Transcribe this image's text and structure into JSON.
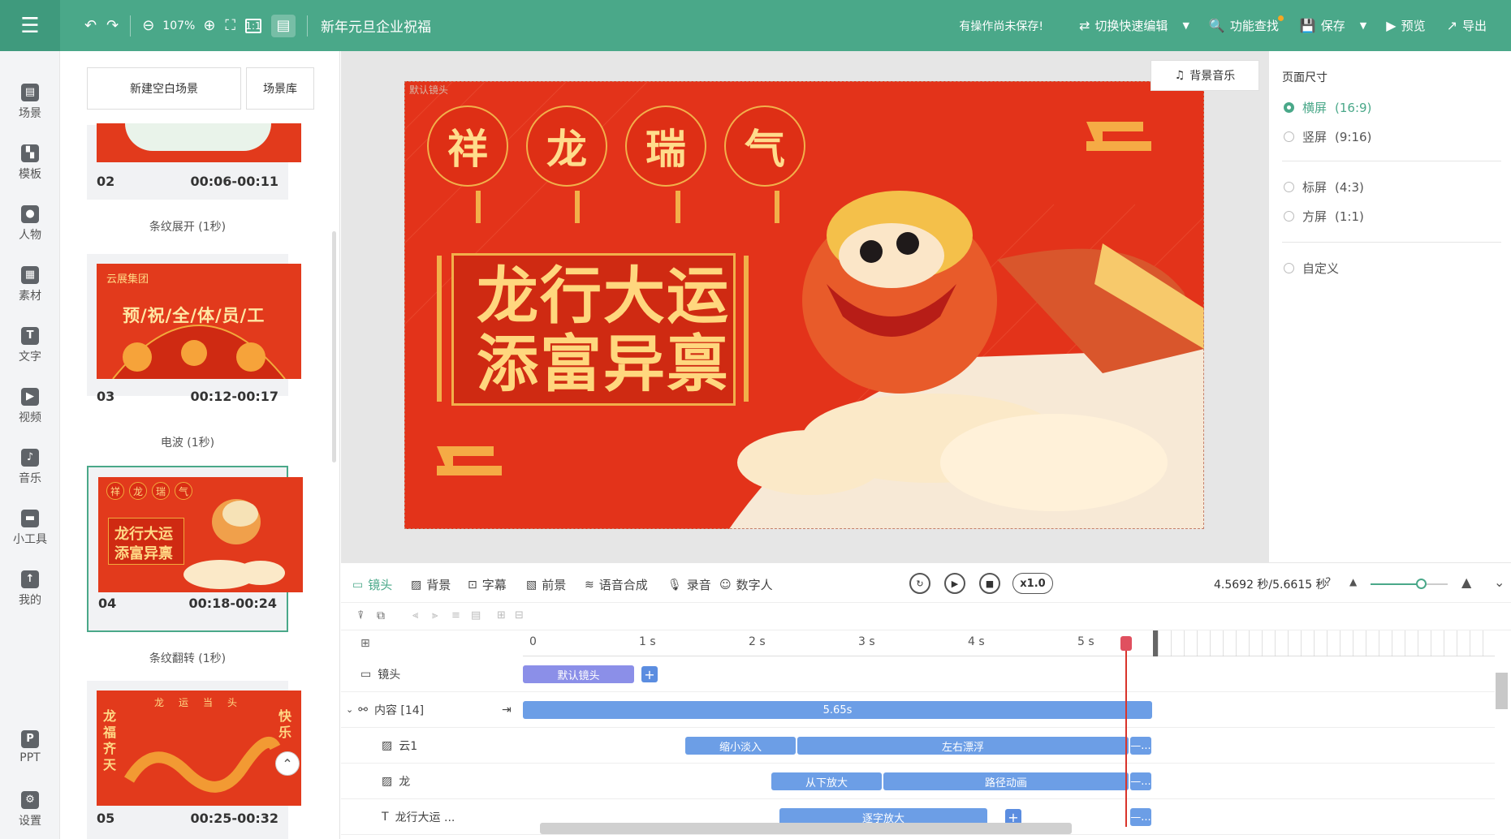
{
  "topbar": {
    "zoom": "107%",
    "doc_title": "新年元旦企业祝福",
    "unsaved_warning": "有操作尚未保存!",
    "switch_label": "切换快速编辑",
    "find_label": "功能查找",
    "save_label": "保存",
    "preview_label": "预览",
    "export_label": "导出"
  },
  "leftnav": {
    "items": [
      {
        "label": "场景",
        "icon": "scene-icon"
      },
      {
        "label": "模板",
        "icon": "template-icon"
      },
      {
        "label": "人物",
        "icon": "person-icon"
      },
      {
        "label": "素材",
        "icon": "material-icon"
      },
      {
        "label": "文字",
        "icon": "text-icon"
      },
      {
        "label": "视频",
        "icon": "video-icon"
      },
      {
        "label": "音乐",
        "icon": "music-icon"
      },
      {
        "label": "小工具",
        "icon": "tools-icon"
      },
      {
        "label": "我的",
        "icon": "upload-icon"
      }
    ],
    "bottom": [
      {
        "label": "PPT",
        "icon": "ppt-icon"
      },
      {
        "label": "设置",
        "icon": "gear-icon"
      }
    ]
  },
  "scenes": {
    "new_blank": "新建空白场景",
    "library": "场景库",
    "cards": [
      {
        "num": "02",
        "time": "00:06-00:11",
        "transition": "条纹展开 (1秒)"
      },
      {
        "num": "03",
        "time": "00:12-00:17",
        "transition": "电波 (1秒)",
        "company": "云展集团",
        "headline": "预/祝/全/体/员/工"
      },
      {
        "num": "04",
        "time": "00:18-00:24",
        "transition": "条纹翻转 (1秒)",
        "lanterns": [
          "祥",
          "龙",
          "瑞",
          "气"
        ],
        "line1": "龙行大运",
        "line2": "添富异禀"
      },
      {
        "num": "05",
        "time": "00:25-00:32",
        "lanterns": [
          "龙",
          "运",
          "当",
          "头"
        ],
        "left_couplet": "龙福齐天",
        "right_couplet": "快乐"
      }
    ]
  },
  "canvas": {
    "camera_label": "默认镜头",
    "bgm_label": "背景音乐",
    "lanterns": [
      "祥",
      "龙",
      "瑞",
      "气"
    ],
    "line1": "龙行大运",
    "line2": "添富异禀"
  },
  "page_size": {
    "title": "页面尺寸",
    "options": [
      {
        "name": "横屏",
        "ratio": "(16:9)",
        "selected": true
      },
      {
        "name": "竖屏",
        "ratio": "(9:16)",
        "selected": false
      },
      {
        "name": "标屏",
        "ratio": "(4:3)",
        "selected": false
      },
      {
        "name": "方屏",
        "ratio": "(1:1)",
        "selected": false
      },
      {
        "name": "自定义",
        "ratio": "",
        "selected": false
      }
    ]
  },
  "timeline": {
    "tabs": [
      "镜头",
      "背景",
      "字幕",
      "前景",
      "语音合成",
      "录音",
      "数字人"
    ],
    "speed": "x1.0",
    "time_info": "4.5692 秒/5.6615 秒",
    "zoom_level": 0.65,
    "ruler": [
      "0",
      "1 s",
      "2 s",
      "3 s",
      "4 s",
      "5 s"
    ],
    "tracks": [
      {
        "label": "镜头",
        "icon": "camera-icon"
      },
      {
        "label": "内容 [14]",
        "icon": "content-icon"
      },
      {
        "label": "云1",
        "icon": "image-icon"
      },
      {
        "label": "龙",
        "icon": "image-icon"
      },
      {
        "label": "龙行大运 ...",
        "icon": "text-box-icon"
      }
    ],
    "clips": {
      "camera": "默认镜头",
      "content": "5.65s",
      "cloud_in": "缩小淡入",
      "cloud_float": "左右漂浮",
      "dragon_in": "从下放大",
      "dragon_path": "路径动画",
      "text_in": "逐字放大",
      "ellipsis": "—..."
    }
  }
}
